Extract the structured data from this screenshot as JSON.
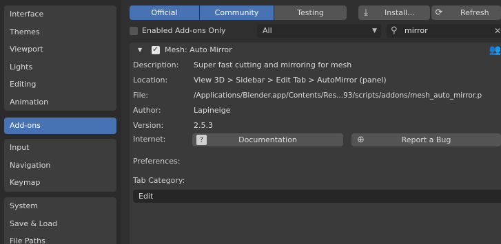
{
  "sidebar": {
    "group1": [
      "Interface",
      "Themes",
      "Viewport",
      "Lights",
      "Editing",
      "Animation"
    ],
    "active": "Add-ons",
    "group2": [
      "Input",
      "Navigation",
      "Keymap"
    ],
    "group3": [
      "System",
      "Save & Load",
      "File Paths"
    ]
  },
  "tabs": [
    "Official",
    "Community",
    "Testing"
  ],
  "actions": {
    "install": "Install...",
    "refresh": "Refresh"
  },
  "filter": {
    "enabled_only_label": "Enabled Add-ons Only",
    "category_value": "All",
    "search_value": "mirror"
  },
  "addon": {
    "title": "Mesh: Auto Mirror",
    "description_label": "Description:",
    "description": "Super fast cutting and mirroring for mesh",
    "location_label": "Location:",
    "location": "View 3D > Sidebar > Edit Tab > AutoMirror (panel)",
    "file_label": "File:",
    "file": "/Applications/Blender.app/Contents/Res...93/scripts/addons/mesh_auto_mirror.p",
    "author_label": "Author:",
    "author": "Lapineige",
    "version_label": "Version:",
    "version": "2.5.3",
    "internet_label": "Internet:",
    "documentation_button": "Documentation",
    "report_bug_button": "Report a Bug",
    "preferences_label": "Preferences:",
    "tab_category_label": "Tab Category:",
    "tab_category_value": "Edit"
  },
  "colors": {
    "accent": "#4772b3",
    "background": "#303030",
    "panel": "#3a3a3a",
    "button": "#545454"
  }
}
